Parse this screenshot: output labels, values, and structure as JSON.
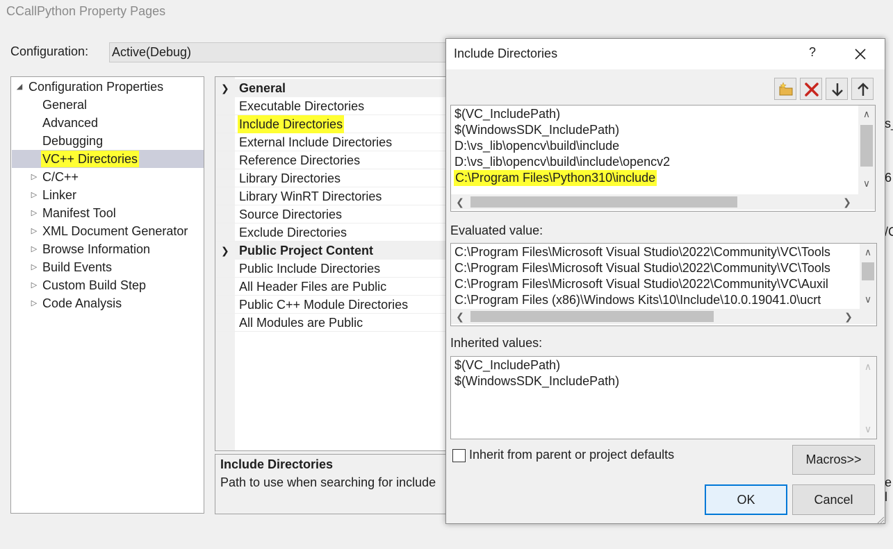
{
  "window": {
    "title": "CCallPython Property Pages"
  },
  "config": {
    "label": "Configuration:",
    "value": "Active(Debug)"
  },
  "tree": {
    "root": "Configuration Properties",
    "items": [
      {
        "label": "General",
        "expander": false
      },
      {
        "label": "Advanced",
        "expander": false
      },
      {
        "label": "Debugging",
        "expander": false
      },
      {
        "label": "VC++ Directories",
        "expander": false,
        "selected": true
      },
      {
        "label": "C/C++",
        "expander": true
      },
      {
        "label": "Linker",
        "expander": true
      },
      {
        "label": "Manifest Tool",
        "expander": true
      },
      {
        "label": "XML Document Generator",
        "expander": true
      },
      {
        "label": "Browse Information",
        "expander": true
      },
      {
        "label": "Build Events",
        "expander": true
      },
      {
        "label": "Custom Build Step",
        "expander": true
      },
      {
        "label": "Code Analysis",
        "expander": true
      }
    ]
  },
  "grid": {
    "categories": [
      {
        "name": "General",
        "rows": [
          "Executable Directories",
          "Include Directories",
          "External Include Directories",
          "Reference Directories",
          "Library Directories",
          "Library WinRT Directories",
          "Source Directories",
          "Exclude Directories"
        ]
      },
      {
        "name": "Public Project Content",
        "rows": [
          "Public Include Directories",
          "All Header Files are Public",
          "Public C++ Module Directories",
          "All Modules are Public"
        ]
      }
    ]
  },
  "description": {
    "title": "Include Directories",
    "text": "Path to use when searching for include"
  },
  "right_edge": {
    "a": "s_",
    "b": "6",
    "c": "/C",
    "d": "e l"
  },
  "dialog": {
    "title": "Include Directories",
    "help": "?",
    "toolbar": [
      "new-line",
      "delete",
      "move-down",
      "move-up"
    ],
    "entries": [
      "$(VC_IncludePath)",
      "$(WindowsSDK_IncludePath)",
      "D:\\vs_lib\\opencv\\build\\include",
      "D:\\vs_lib\\opencv\\build\\include\\opencv2",
      "C:\\Program Files\\Python310\\include"
    ],
    "evaluated_label": "Evaluated value:",
    "evaluated": [
      "C:\\Program Files\\Microsoft Visual Studio\\2022\\Community\\VC\\Tools",
      "C:\\Program Files\\Microsoft Visual Studio\\2022\\Community\\VC\\Tools",
      "C:\\Program Files\\Microsoft Visual Studio\\2022\\Community\\VC\\Auxil",
      "C:\\Program Files (x86)\\Windows Kits\\10\\Include\\10.0.19041.0\\ucrt"
    ],
    "inherited_label": "Inherited values:",
    "inherited": [
      "$(VC_IncludePath)",
      "$(WindowsSDK_IncludePath)"
    ],
    "inherit_checkbox": "Inherit from parent or project defaults",
    "macros": "Macros>>",
    "ok": "OK",
    "cancel": "Cancel"
  },
  "colors": {
    "highlight": "#ffff33",
    "selection": "#cccedb",
    "accent": "#0078d7"
  }
}
